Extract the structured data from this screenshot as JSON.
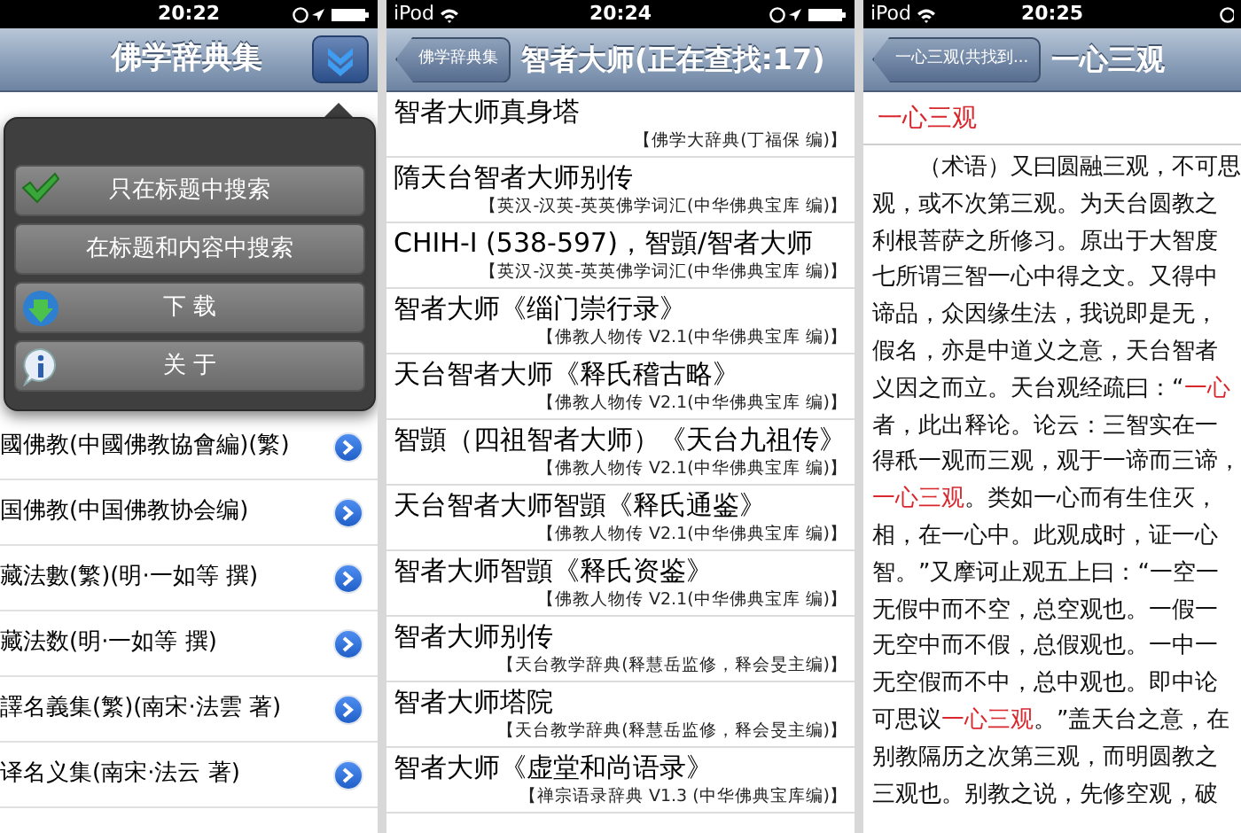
{
  "left": {
    "status_bar": {
      "time": "20:22"
    },
    "nav": {
      "title": "佛学辞典集"
    },
    "menu": [
      {
        "kind": "check",
        "label": "只在标题中搜索"
      },
      {
        "kind": "plain",
        "label": "在标题和内容中搜索"
      },
      {
        "kind": "download",
        "label": "下 载"
      },
      {
        "kind": "info",
        "label": "关 于"
      }
    ],
    "rows": [
      "國佛教(中國佛教協會編)(繁)",
      "国佛教(中国佛教协会编)",
      "藏法數(繁)(明·一如等 撰)",
      "藏法数(明·一如等 撰)",
      "譯名義集(繁)(南宋·法雲 著)",
      "译名义集(南宋·法云 著)"
    ]
  },
  "middle": {
    "status_bar": {
      "carrier": "iPod",
      "time": "20:24"
    },
    "nav": {
      "back": "佛学辞典集",
      "title": "智者大师(正在查找:17)"
    },
    "results": [
      {
        "title": "智者大师真身塔",
        "source": "【佛学大辞典(丁福保 编)】"
      },
      {
        "title": "隋天台智者大师别传",
        "source": "【英汉-汉英-英英佛学词汇(中华佛典宝库 编)】"
      },
      {
        "title": "CHIH-I (538-597)，智顗/智者大师",
        "source": "【英汉-汉英-英英佛学词汇(中华佛典宝库 编)】"
      },
      {
        "title": "智者大师《缁门崇行录》",
        "source": "【佛教人物传 V2.1(中华佛典宝库 编)】"
      },
      {
        "title": "天台智者大师《释氏稽古略》",
        "source": "【佛教人物传 V2.1(中华佛典宝库 编)】"
      },
      {
        "title": "智顗（四祖智者大师）《天台九祖传》",
        "source": "【佛教人物传 V2.1(中华佛典宝库 编)】"
      },
      {
        "title": "天台智者大师智顗《释氏通鉴》",
        "source": "【佛教人物传 V2.1(中华佛典宝库 编)】"
      },
      {
        "title": "智者大师智顗《释氏资鉴》",
        "source": "【佛教人物传 V2.1(中华佛典宝库 编)】"
      },
      {
        "title": "智者大师别传",
        "source": "【天台教学辞典(释慧岳监修，释会旻主编)】"
      },
      {
        "title": "智者大师塔院",
        "source": "【天台教学辞典(释慧岳监修，释会旻主编)】"
      },
      {
        "title": "智者大师《虚堂和尚语录》",
        "source": "【禅宗语录辞典 V1.3 (中华佛典宝库编)】"
      }
    ]
  },
  "right": {
    "status_bar": {
      "carrier": "iPod",
      "time": "20:25"
    },
    "nav": {
      "back": "一心三观(共找到...",
      "title": "一心三观"
    },
    "heading": "一心三观",
    "lines": [
      [
        {
          "text": "（术语）又曰圆融三观，不可思",
          "highlight": false
        }
      ],
      [
        {
          "text": "观，或不次第三观。为天台圆教之",
          "highlight": false
        }
      ],
      [
        {
          "text": "利根菩萨之所修习。原出于大智度",
          "highlight": false
        }
      ],
      [
        {
          "text": "七所谓三智一心中得之文。又得中",
          "highlight": false
        }
      ],
      [
        {
          "text": "谛品，众因缘生法，我说即是无，",
          "highlight": false
        }
      ],
      [
        {
          "text": "假名，亦是中道义之意，天台智者",
          "highlight": false
        }
      ],
      [
        {
          "text": "义因之而立。天台观经疏曰：“",
          "highlight": false
        },
        {
          "text": "一心",
          "highlight": true
        }
      ],
      [
        {
          "text": "者，此出释论。论云：三智实在一",
          "highlight": false
        }
      ],
      [
        {
          "text": "得秖一观而三观，观于一谛而三谛，",
          "highlight": false
        }
      ],
      [
        {
          "text": "一心三观",
          "highlight": true
        },
        {
          "text": "。类如一心而有生住灭，",
          "highlight": false
        }
      ],
      [
        {
          "text": "相，在一心中。此观成时，证一心",
          "highlight": false
        }
      ],
      [
        {
          "text": "智。”又摩诃止观五上曰：“一空一",
          "highlight": false
        }
      ],
      [
        {
          "text": "无假中而不空，总空观也。一假一",
          "highlight": false
        }
      ],
      [
        {
          "text": "无空中而不假，总假观也。一中一",
          "highlight": false
        }
      ],
      [
        {
          "text": "无空假而不中，总中观也。即中论",
          "highlight": false
        }
      ],
      [
        {
          "text": "可思议",
          "highlight": false
        },
        {
          "text": "一心三观",
          "highlight": true
        },
        {
          "text": "。”盖天台之意，在",
          "highlight": false
        }
      ],
      [
        {
          "text": "别教隔历之次第三观，而明圆教之",
          "highlight": false
        }
      ],
      [
        {
          "text": "三观也。别教之说，先修空观，破",
          "highlight": false
        }
      ]
    ]
  }
}
